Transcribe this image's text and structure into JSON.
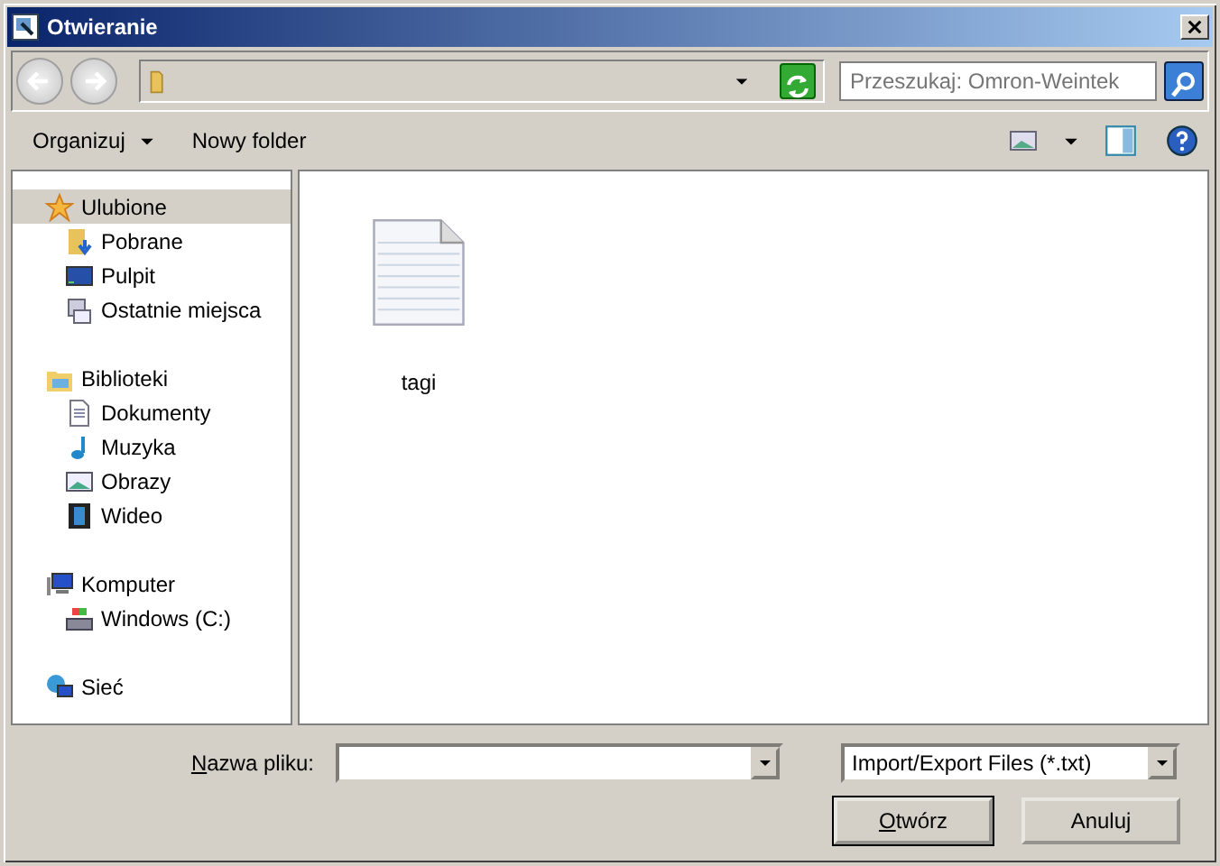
{
  "window": {
    "title": "Otwieranie"
  },
  "search": {
    "placeholder": "Przeszukaj: Omron-Weintek"
  },
  "toolbar": {
    "buttons": [
      {
        "label": "Organizuj",
        "dropdown": true
      },
      {
        "label": "Nowy folder",
        "dropdown": false
      }
    ]
  },
  "sidebar": {
    "groups": [
      {
        "label": "Ulubione",
        "kind": "star",
        "selected": true,
        "children": [
          {
            "label": "Pobrane",
            "kind": "download",
            "selected": false
          },
          {
            "label": "Pulpit",
            "kind": "desktop",
            "selected": false
          },
          {
            "label": "Ostatnie miejsca",
            "kind": "recent",
            "selected": false
          }
        ]
      },
      {
        "label": "Biblioteki",
        "kind": "library",
        "selected": false,
        "children": [
          {
            "label": "Dokumenty",
            "kind": "document",
            "selected": false
          },
          {
            "label": "Muzyka",
            "kind": "music",
            "selected": false
          },
          {
            "label": "Obrazy",
            "kind": "image",
            "selected": false
          },
          {
            "label": "Wideo",
            "kind": "video",
            "selected": false
          }
        ]
      },
      {
        "label": "Komputer",
        "kind": "computer",
        "selected": false,
        "children": [
          {
            "label": "Windows (C:)",
            "kind": "drive",
            "selected": false
          }
        ]
      },
      {
        "label": "Sieć",
        "kind": "network",
        "selected": false
      }
    ]
  },
  "files": [
    {
      "name": "tagi",
      "selected": false
    }
  ],
  "file_name": {
    "label": "Nazwa pliku:",
    "underline_first": true
  },
  "file_type": {
    "value": "Import/Export Files (*.txt)"
  },
  "buttons": [
    {
      "label": "Otwórz",
      "underline_first": true,
      "default": true
    },
    {
      "label": "Anuluj",
      "underline_first": false,
      "default": false
    }
  ]
}
